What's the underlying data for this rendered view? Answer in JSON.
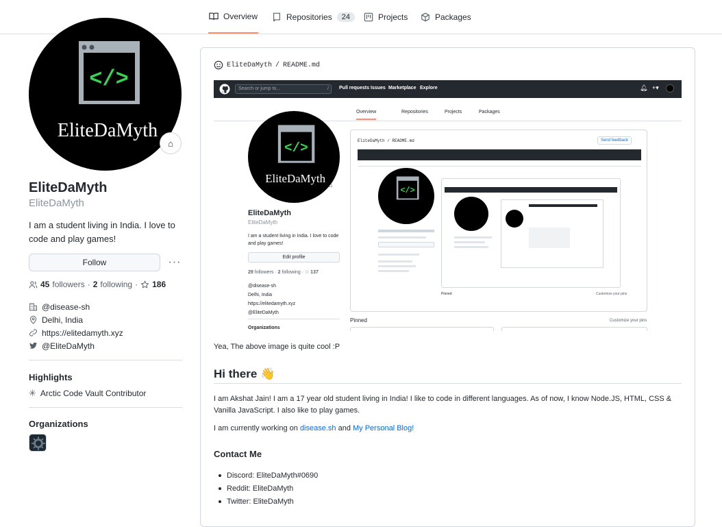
{
  "tabs": [
    {
      "label": "Overview",
      "icon": "book-icon",
      "active": true
    },
    {
      "label": "Repositories",
      "icon": "repo-icon",
      "count": "24"
    },
    {
      "label": "Projects",
      "icon": "project-icon"
    },
    {
      "label": "Packages",
      "icon": "package-icon"
    }
  ],
  "profile": {
    "avatar_text": "EliteDaMyth",
    "name": "EliteDaMyth",
    "login": "EliteDaMyth",
    "bio": "I am a student living in India. I love to code and play games!",
    "follow_label": "Follow",
    "more_label": "···",
    "followers_count": "45",
    "followers_label": "followers",
    "following_count": "2",
    "following_label": "following",
    "stars_count": "186",
    "company": "@disease-sh",
    "location": "Delhi, India",
    "website": "https://elitedamyth.xyz",
    "twitter": "@EliteDaMyth"
  },
  "highlights": {
    "title": "Highlights",
    "item": "Arctic Code Vault Contributor"
  },
  "organizations": {
    "title": "Organizations"
  },
  "readme": {
    "path_user": "EliteDaMyth",
    "path_sep": "/",
    "path_file": "README.md",
    "caption": "Yea, The above image is quite cool :P",
    "heading": "Hi there",
    "wave": "👋",
    "intro": "I am Akshat Jain! I am a 17 year old student living in India! I like to code in different languages. As of now, I know Node.JS, HTML, CSS & Vanilla JavaScript. I also like to play games.",
    "working_prefix": "I am currently working on ",
    "working_link1": "disease.sh",
    "working_and": " and ",
    "working_link2": "My Personal Blog!",
    "contact_title": "Contact Me",
    "contacts": [
      "Discord: EliteDaMyth#0690",
      "Reddit: EliteDaMyth",
      "Twitter: EliteDaMyth"
    ]
  },
  "embedded_shot": {
    "search_placeholder": "Search or jump to...",
    "search_key": "/",
    "nav": [
      "Pull requests",
      "Issues",
      "Marketplace",
      "Explore"
    ],
    "tabs": [
      "Overview",
      "Repositories",
      "Projects",
      "Packages"
    ],
    "name": "EliteDaMyth",
    "login": "EliteDaMyth",
    "bio": "I am a student living in India. I love to code and play games!",
    "edit_label": "Edit profile",
    "followers_count": "29",
    "followers_label": "followers",
    "following_count": "2",
    "following_label": "following",
    "stars_count": "137",
    "company": "@disease-sh",
    "location": "Delhi, India",
    "website": "https://elitedamyth.xyz",
    "twitter": "@EliteDaMyth",
    "orgs_label": "Organizations",
    "readme_path": "EliteDaMyth / README.md",
    "feedback_label": "Send feedback",
    "pinned_label": "Pinned",
    "customize_label": "Customize your pins"
  },
  "colors": {
    "accent": "#fd8c73",
    "link": "#0969da",
    "code_green": "#39d353"
  }
}
